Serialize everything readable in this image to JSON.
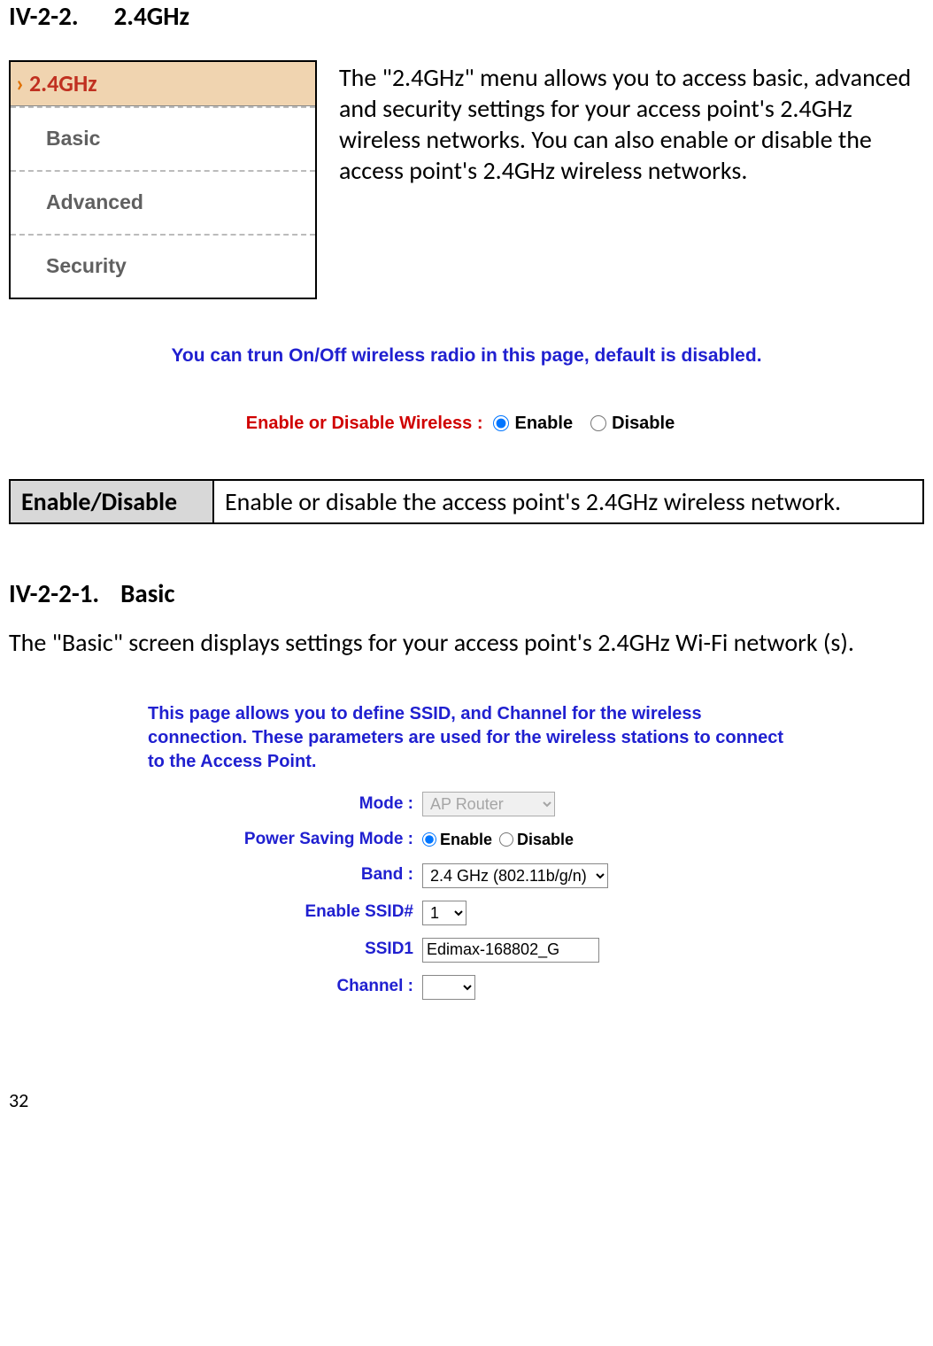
{
  "heading1": {
    "num": "IV-2-2.",
    "title": "2.4GHz"
  },
  "nav": {
    "header": "2.4GHz",
    "items": [
      "Basic",
      "Advanced",
      "Security"
    ]
  },
  "intro_text": "The \"2.4GHz\" menu allows you to access basic, advanced and security settings for your access point's 2.4GHz wireless networks. You can also enable or disable the access point's 2.4GHz wireless networks.",
  "hint_line": "You can trun On/Off wireless radio in this page, default is disabled.",
  "enable_control": {
    "label": "Enable or Disable Wireless :",
    "opt_enable": "Enable",
    "opt_disable": "Disable"
  },
  "table1": {
    "th": "Enable/Disable",
    "td": "Enable or disable the access point's 2.4GHz wireless network."
  },
  "heading2": {
    "num": "IV-2-2-1.",
    "title": "Basic"
  },
  "body2": "The \"Basic\" screen displays settings for your access point's 2.4GHz Wi-Fi network (s).",
  "form_intro": "This page allows you to define SSID, and Channel for the wireless connection. These parameters are used for the wireless stations to connect to the Access Point.",
  "form": {
    "mode_label": "Mode :",
    "mode_value": "AP Router",
    "psm_label": "Power Saving Mode :",
    "psm_enable": "Enable",
    "psm_disable": "Disable",
    "band_label": "Band :",
    "band_value": "2.4 GHz (802.11b/g/n)",
    "essid_label": "Enable SSID#",
    "essid_value": "1",
    "ssid1_label": "SSID1",
    "ssid1_value": "Edimax-168802_G",
    "channel_label": "Channel :",
    "channel_value": ""
  },
  "page_number": "32"
}
